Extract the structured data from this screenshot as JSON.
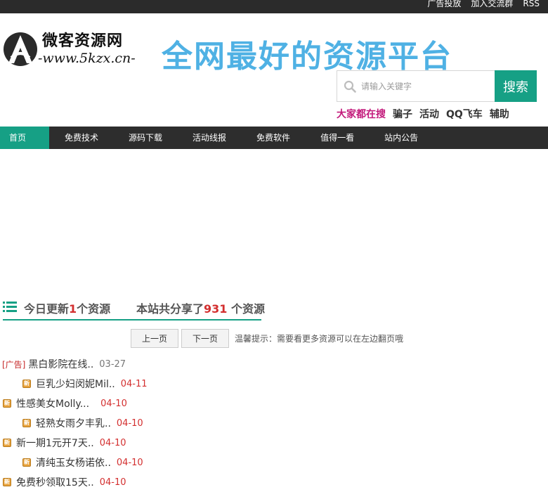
{
  "topbar": {
    "links": [
      "广告投放",
      "加入交流群",
      "RSS"
    ]
  },
  "logo": {
    "name": "微客资源网",
    "url": "-www.5kzx.cn-"
  },
  "slogan": "全网最好的资源平台",
  "search": {
    "placeholder": "请输入关键字",
    "button": "搜索"
  },
  "hot": {
    "title": "大家都在搜",
    "items": [
      "骗子",
      "活动",
      "QQ飞车",
      "辅助"
    ]
  },
  "nav": {
    "items": [
      "首页",
      "免费技术",
      "源码下载",
      "活动线报",
      "免费软件",
      "值得一看",
      "站内公告"
    ],
    "active_index": 0
  },
  "stats": {
    "today_prefix": "今日更新",
    "today_count": "1",
    "today_suffix": "个资源",
    "total_prefix": "本站共分享了",
    "total_count": "931",
    "total_suffix": " 个资源"
  },
  "pager": {
    "prev": "上一页",
    "next": "下一页",
    "tip": "温馨提示：需要看更多资源可以在左边翻页哦"
  },
  "list": [
    {
      "tag": "[广告]",
      "title": "黑白影院在线..",
      "date": "03-27",
      "indent": false,
      "ad": true
    },
    {
      "tag": "新",
      "title": "巨乳少妇闵妮Mil..",
      "date": "04-11",
      "indent": true,
      "ad": false
    },
    {
      "tag": "新",
      "title": "性感美女Molly...",
      "date": "04-10",
      "indent": false,
      "ad": false
    },
    {
      "tag": "新",
      "title": "轻熟女雨夕丰乳..",
      "date": "04-10",
      "indent": true,
      "ad": false
    },
    {
      "tag": "新",
      "title": "新一期1元开7天..",
      "date": "04-10",
      "indent": false,
      "ad": false
    },
    {
      "tag": "新",
      "title": "清纯玉女杨诺依..",
      "date": "04-10",
      "indent": true,
      "ad": false
    },
    {
      "tag": "新",
      "title": "免费秒领取15天..",
      "date": "04-10",
      "indent": false,
      "ad": false
    }
  ],
  "colors": {
    "accent": "#16a085",
    "topbar": "#2b2b2b",
    "nav": "#2d2d2d",
    "slogan": "#4fb1e4",
    "hot_title": "#c2187a",
    "date_red": "#d32f2f"
  }
}
